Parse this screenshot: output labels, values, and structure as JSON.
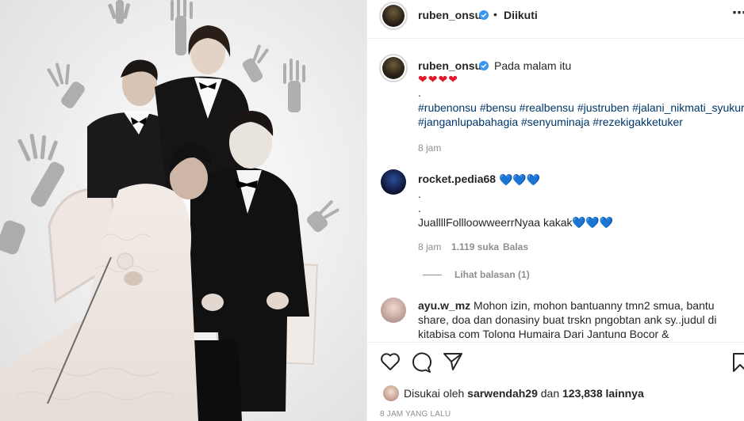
{
  "header": {
    "username": "ruben_onsu",
    "separator": "•",
    "follow_status": "Diikuti",
    "more_icon": "more-options-icon"
  },
  "caption": {
    "username": "ruben_onsu",
    "text": "Pada malam itu",
    "hearts": "❤❤❤❤",
    "dot": ".",
    "hashtags": "#rubenonsu #bensu #realbensu #justruben #jalani_nikmati_syukuri #janganlupabahagia #senyuminaja #rezekigakketuker",
    "time": "8 jam"
  },
  "comments": [
    {
      "username": "rocket.pedia68",
      "hearts": "💙💙💙",
      "line2": ".",
      "line3": ".",
      "line4": "JuallllFollloowweerrNyaa kakak",
      "line4_hearts": "💙💙💙",
      "time": "8 jam",
      "likes": "1.119 suka",
      "reply": "Balas",
      "view_replies": "Lihat balasan (1)"
    },
    {
      "username": "ayu.w_mz",
      "text": "Mohon izin, mohon bantuanny tmn2 smua, bantu share, doa dan donasiny buat trskn pngobtan ank sy..judul di kitabisa com Tolong Humaira Dari Jantung Bocor &"
    }
  ],
  "actions": {
    "like_icon": "heart-icon",
    "comment_icon": "comment-icon",
    "share_icon": "share-icon",
    "save_icon": "bookmark-icon"
  },
  "likes": {
    "prefix": "Disukai oleh",
    "user": "sarwendah29",
    "middle": "dan",
    "count": "123,838 lainnya"
  },
  "posted_ago": "8 JAM YANG LALU",
  "colors": {
    "link": "#00376b",
    "muted": "#8e8e8e",
    "verified": "#3897f0",
    "heart": "#e0192b"
  }
}
